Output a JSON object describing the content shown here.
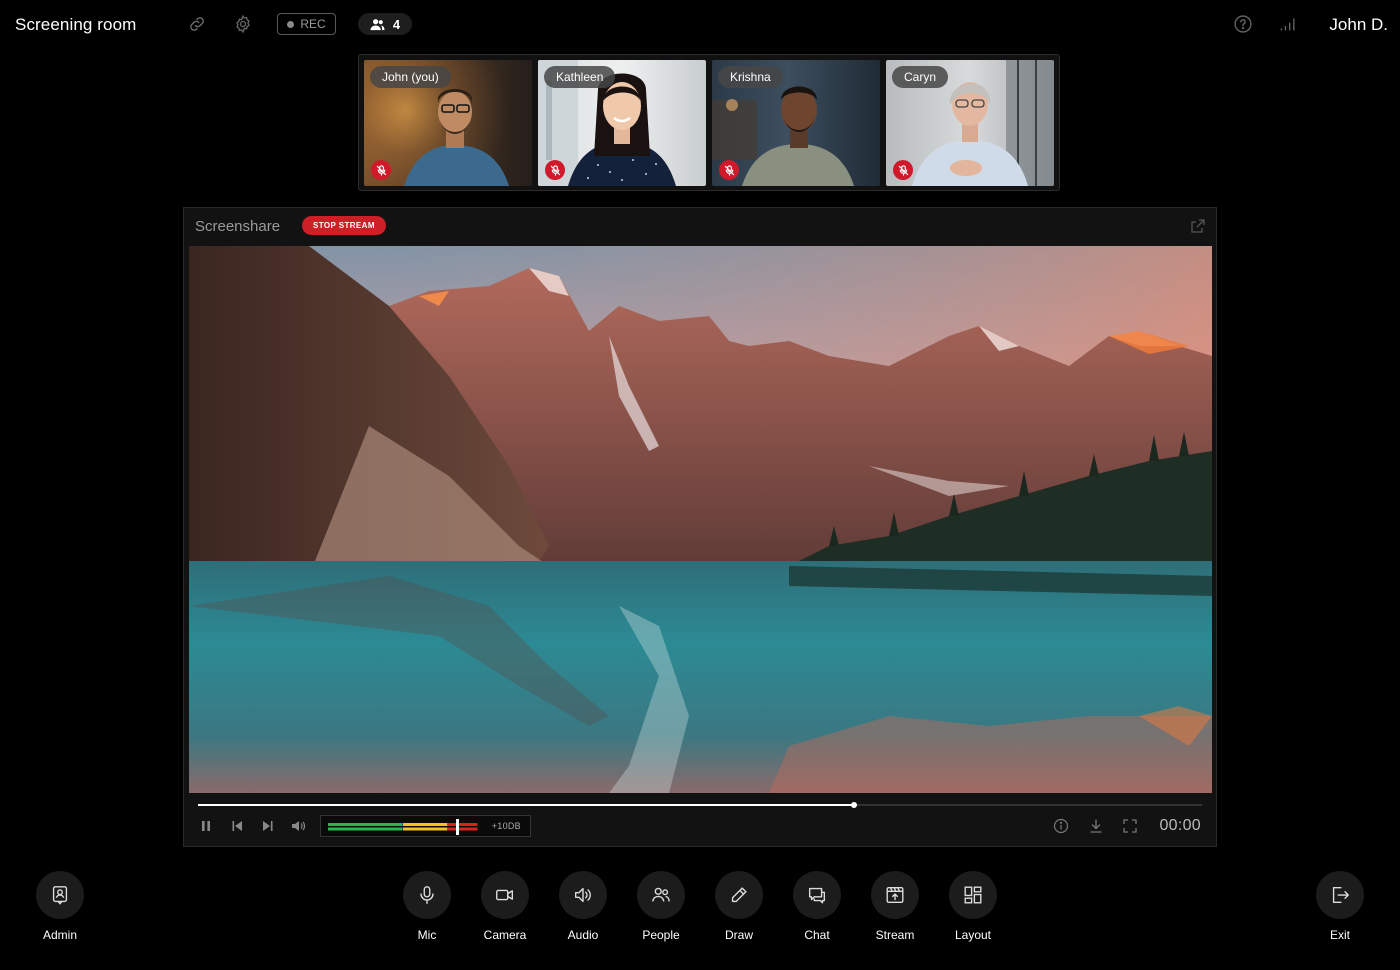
{
  "header": {
    "room_title": "Screening room",
    "rec_label": "REC",
    "participant_count": "4",
    "user_name": "John D.",
    "icons": [
      "link-icon",
      "gear-icon",
      "help-icon",
      "signal-icon"
    ]
  },
  "participants": [
    {
      "name": "John (you)",
      "muted": true
    },
    {
      "name": "Kathleen",
      "muted": true
    },
    {
      "name": "Krishna",
      "muted": true
    },
    {
      "name": "Caryn",
      "muted": true
    }
  ],
  "screenshare": {
    "title": "Screenshare",
    "stop_label": "STOP STREAM",
    "progress": 0.653,
    "meter_label": "+10DB",
    "meter_level": 0.85,
    "timecode": "00:00"
  },
  "toolbar": {
    "admin": "Admin",
    "mic": "Mic",
    "camera": "Camera",
    "audio": "Audio",
    "people": "People",
    "draw": "Draw",
    "chat": "Chat",
    "stream": "Stream",
    "layout": "Layout",
    "exit": "Exit"
  },
  "colors": {
    "background": "#000000",
    "stop_red": "#cc1f26",
    "mute_red": "#d0192b",
    "meter_green": "#2eb34f",
    "meter_yellow": "#f0c419",
    "meter_red": "#e02020"
  }
}
